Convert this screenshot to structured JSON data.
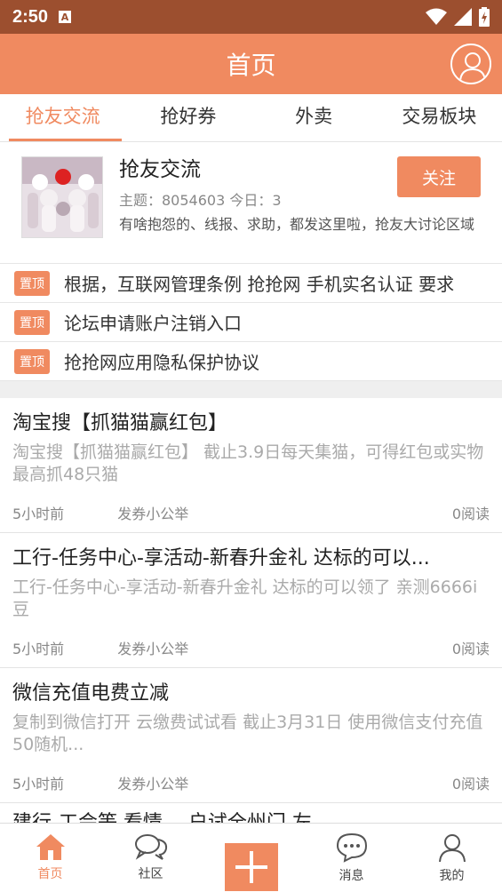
{
  "statusbar": {
    "time": "2:50",
    "notif_letter": "A"
  },
  "header": {
    "title": "首页"
  },
  "tabs": [
    {
      "label": "抢友交流",
      "active": true
    },
    {
      "label": "抢好券"
    },
    {
      "label": "外卖"
    },
    {
      "label": "交易板块"
    }
  ],
  "forum": {
    "name": "抢友交流",
    "stats": "主题：8054603  今日：3",
    "desc": "有啥抱怨的、线报、求助，都发这里啦，抢友大讨论区域",
    "follow_label": "关注"
  },
  "pinned": [
    {
      "badge": "置顶",
      "title": "根据，互联网管理条例 抢抢网 手机实名认证 要求"
    },
    {
      "badge": "置顶",
      "title": "论坛申请账户注销入口"
    },
    {
      "badge": "置顶",
      "title": "抢抢网应用隐私保护协议"
    }
  ],
  "posts": [
    {
      "title": "淘宝搜【抓猫猫赢红包】",
      "excerpt": "淘宝搜【抓猫猫赢红包】   截止3.9日每天集猫，可得红包或实物  最高抓48只猫",
      "time": "5小时前",
      "author": "发券小公举",
      "reads": "0阅读"
    },
    {
      "title": "工行-任务中心-享活动-新春升金礼 达标的可以...",
      "excerpt": "工行-任务中心-享活动-新春升金礼 达标的可以领了 亲测6666i豆",
      "time": "5小时前",
      "author": "发券小公举",
      "reads": "0阅读"
    },
    {
      "title": "微信充值电费立减",
      "excerpt": "复制到微信打开    云缴费试试看 截止3月31日   使用微信支付充值50随机...",
      "time": "5小时前",
      "author": "发券小公举",
      "reads": "0阅读"
    }
  ],
  "partial_post_title": "建行-工会等 看情...-户试全州门.左",
  "bottomnav": {
    "home": "首页",
    "community": "社区",
    "messages": "消息",
    "mine": "我的"
  },
  "colors": {
    "accent": "#f08a60",
    "statusbar": "#9c4f2f"
  }
}
